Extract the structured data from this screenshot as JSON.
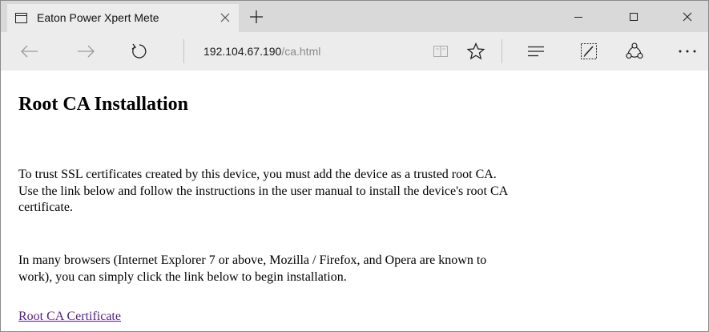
{
  "browser": {
    "tab": {
      "title": "Eaton Power Xpert Mete"
    },
    "address": {
      "host": "192.104.67.190",
      "path": "/ca.html"
    }
  },
  "page": {
    "heading": "Root CA Installation",
    "paragraph1": {
      "lines": [
        "To trust SSL certificates created by this device, you must add the device as a trusted root CA.",
        "Use the link below and follow the instructions in the user manual to install the device's root CA",
        "certificate."
      ]
    },
    "paragraph2": {
      "lines": [
        "In many browsers (Internet Explorer 7 or above, Mozilla / Firefox, and Opera are known to",
        "work), you can simply click the link below to begin installation."
      ]
    },
    "link_text": "Root CA Certificate"
  },
  "colors": {
    "tabbar_bg": "#d9d9d9",
    "toolbar_bg": "#ececec",
    "visited_link": "#551a8b"
  },
  "icons": {
    "tab": "page-icon",
    "tab_close": "close-icon",
    "new_tab": "plus-icon",
    "minimize": "minimize-icon",
    "maximize": "maximize-icon",
    "close": "close-icon",
    "back": "back-arrow-icon",
    "forward": "forward-arrow-icon",
    "refresh": "refresh-icon",
    "reading_view": "book-icon",
    "favorite": "star-icon",
    "hub": "hub-icon",
    "web_note": "web-note-icon",
    "share": "share-icon",
    "more": "more-icon"
  }
}
